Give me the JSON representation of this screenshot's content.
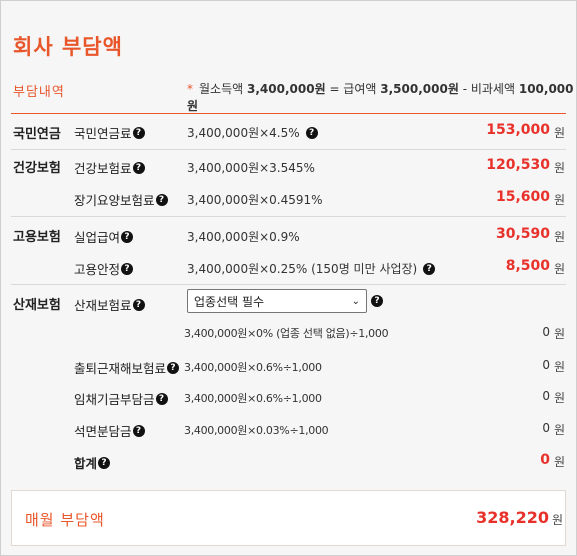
{
  "page": {
    "title": "회사 부담액",
    "section_label": "부담내역",
    "formula": {
      "star": "*",
      "text1": "월소득액",
      "value1": "3,400,000원",
      "text2": "= 급여액",
      "value2": "3,500,000원",
      "text3": "- 비과세액",
      "value3": "100,000원"
    }
  },
  "rows": {
    "national_pension": {
      "category": "국민연금",
      "item": "국민연금료",
      "calc": "3,400,000원×4.5%",
      "amount": "153,000",
      "unit": "원"
    },
    "health_insurance": {
      "category": "건강보험",
      "item": "건강보험료",
      "calc": "3,400,000원×3.545%",
      "amount": "120,530",
      "unit": "원"
    },
    "long_term_care": {
      "item": "장기요양보험료",
      "calc": "3,400,000원×0.4591%",
      "amount": "15,600",
      "unit": "원"
    },
    "employment_benefit": {
      "category": "고용보험",
      "item": "실업급여",
      "calc": "3,400,000원×0.9%",
      "amount": "30,590",
      "unit": "원"
    },
    "employment_stability": {
      "item": "고용안정",
      "calc": "3,400,000원×0.25% (150명 미만 사업장)",
      "amount": "8,500",
      "unit": "원"
    },
    "industrial_accident": {
      "category": "산재보험",
      "item": "산재보험료",
      "select_value": "업종선택 필수",
      "calc": "3,400,000원×0% (업종 선택 없음)÷1,000",
      "amount": "0",
      "unit": "원"
    },
    "commute_accident": {
      "item": "출퇴근재해보험료",
      "calc": "3,400,000원×0.6%÷1,000",
      "amount": "0",
      "unit": "원"
    },
    "wage_claim": {
      "item": "임채기금부담금",
      "calc": "3,400,000원×0.6%÷1,000",
      "amount": "0",
      "unit": "원"
    },
    "asbestos": {
      "item": "석면분담금",
      "calc": "3,400,000원×0.03%÷1,000",
      "amount": "0",
      "unit": "원"
    },
    "subtotal": {
      "item": "합계",
      "amount": "0",
      "unit": "원"
    }
  },
  "total": {
    "label": "매월 부담액",
    "amount": "328,220",
    "unit": "원"
  },
  "icons": {
    "help": "?"
  },
  "colors": {
    "accent": "#e8562a",
    "amount": "#e8312a"
  }
}
